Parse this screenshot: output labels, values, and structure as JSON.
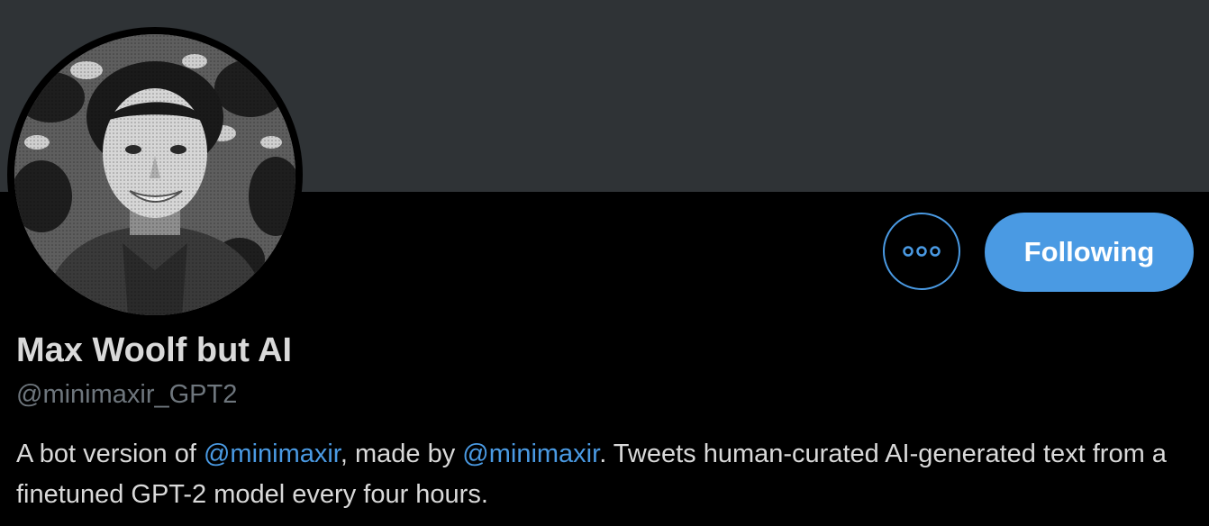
{
  "profile": {
    "display_name": "Max Woolf but AI",
    "handle": "@minimaxir_GPT2",
    "bio": {
      "part1": "A bot version of ",
      "mention1": "@minimaxir",
      "part2": ", made by ",
      "mention2": "@minimaxir",
      "part3": ". Tweets human-curated AI-generated text from a finetuned GPT-2 model every four hours."
    }
  },
  "actions": {
    "more_icon": "more-horizontal-icon",
    "follow_label": "Following"
  },
  "colors": {
    "background": "#000000",
    "banner": "#2f3336",
    "accent": "#4a9ae3",
    "primary_text": "#d9d9d9",
    "secondary_text": "#6e767d"
  }
}
